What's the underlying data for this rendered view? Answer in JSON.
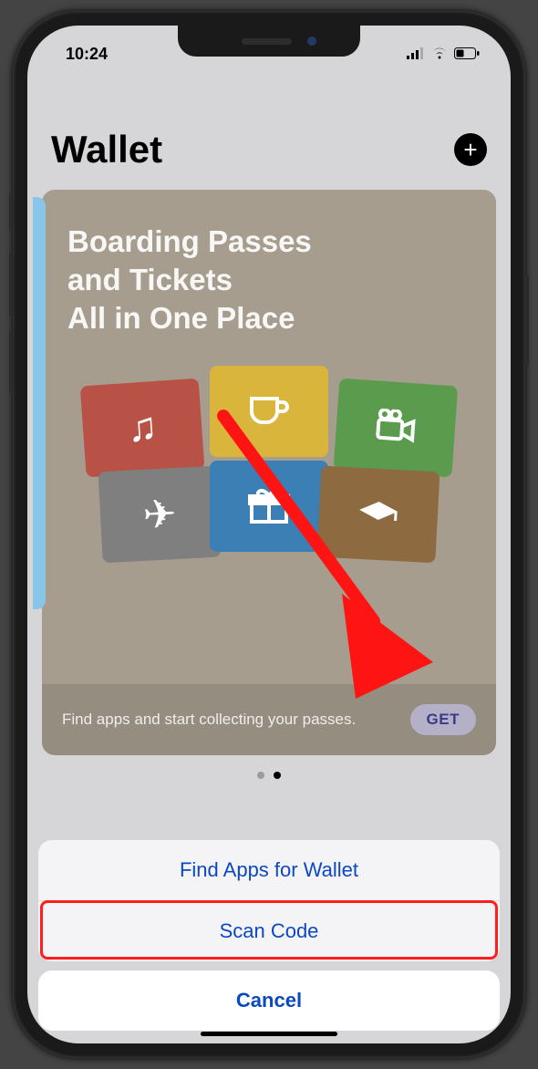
{
  "status": {
    "time": "10:24"
  },
  "header": {
    "title": "Wallet"
  },
  "card": {
    "title_line1": "Boarding Passes",
    "title_line2": "and Tickets",
    "title_line3": "All in One Place",
    "footer_text": "Find apps and start collecting your passes.",
    "get_label": "GET"
  },
  "sheet": {
    "find_label": "Find Apps for Wallet",
    "scan_label": "Scan Code",
    "cancel_label": "Cancel"
  },
  "colors": {
    "accent_blue": "#0a49c2",
    "highlight_red": "#ff1e1e"
  }
}
